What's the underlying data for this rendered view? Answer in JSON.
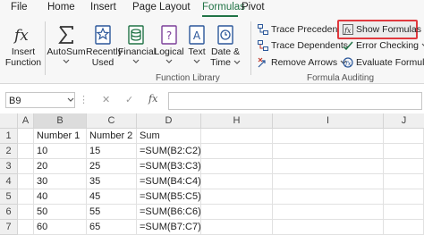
{
  "tabs": [
    "File",
    "Home",
    "Insert",
    "Page Layout",
    "Formulas",
    "Pivot"
  ],
  "active_tab": "Formulas",
  "function_library": {
    "insert_function": [
      "Insert",
      "Function"
    ],
    "autosum": "AutoSum",
    "recently_used": [
      "Recently",
      "Used"
    ],
    "financial": "Financial",
    "logical": "Logical",
    "text": "Text",
    "date_time": [
      "Date &",
      "Time"
    ],
    "group_label": "Function Library"
  },
  "formula_auditing": {
    "trace_precedents": "Trace Precedents",
    "trace_dependents": "Trace Dependents",
    "remove_arrows": "Remove Arrows",
    "show_formulas": "Show Formulas",
    "error_checking": "Error Checking",
    "evaluate_formula": "Evaluate Formula",
    "group_label": "Formula Auditing",
    "show_formulas_highlight": "#e0393e"
  },
  "formula_bar": {
    "name_box": "B9",
    "cancel_symbol": "✕",
    "enter_symbol": "✓",
    "fx_symbol": "fx",
    "value": ""
  },
  "grid": {
    "columns": [
      "A",
      "B",
      "C",
      "D",
      "H",
      "I",
      "J"
    ],
    "rows": [
      {
        "n": "1",
        "A": "",
        "B": "Number 1",
        "C": "Number 2",
        "D": "Sum"
      },
      {
        "n": "2",
        "A": "",
        "B": "10",
        "C": "15",
        "D": "=SUM(B2:C2)"
      },
      {
        "n": "3",
        "A": "",
        "B": "20",
        "C": "25",
        "D": "=SUM(B3:C3)"
      },
      {
        "n": "4",
        "A": "",
        "B": "30",
        "C": "35",
        "D": "=SUM(B4:C4)"
      },
      {
        "n": "5",
        "A": "",
        "B": "40",
        "C": "45",
        "D": "=SUM(B5:C5)"
      },
      {
        "n": "6",
        "A": "",
        "B": "50",
        "C": "55",
        "D": "=SUM(B6:C6)"
      },
      {
        "n": "7",
        "A": "",
        "B": "60",
        "C": "65",
        "D": "=SUM(B7:C7)"
      }
    ]
  },
  "colors": {
    "accent": "#217346",
    "header_bg": "#efefef"
  }
}
